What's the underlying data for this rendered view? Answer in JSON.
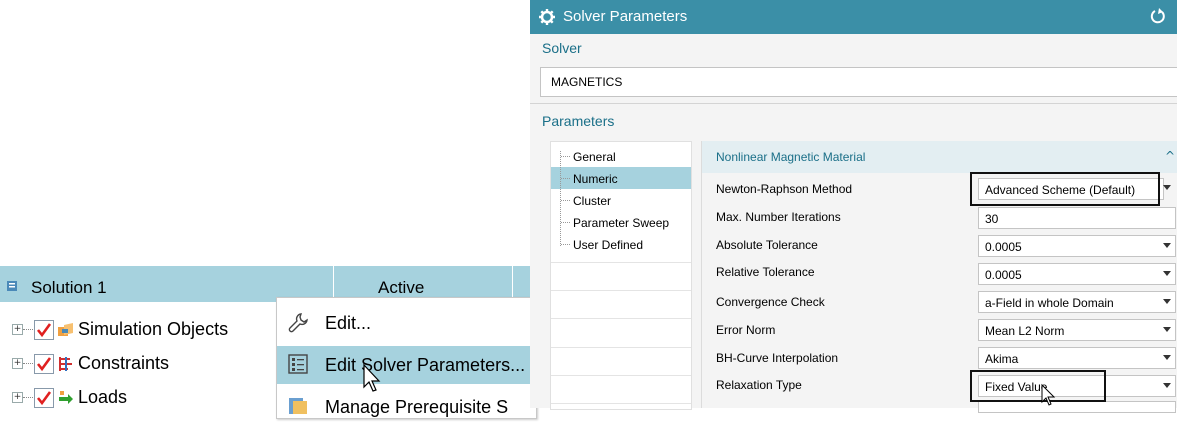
{
  "tree": {
    "header_title": "Solution 1",
    "header_column": "Active",
    "rows": [
      {
        "label": "Simulation Objects",
        "icon": "simulation-objects-icon"
      },
      {
        "label": "Constraints",
        "icon": "constraints-icon"
      },
      {
        "label": "Loads",
        "icon": "loads-icon"
      }
    ]
  },
  "context_menu": {
    "items": [
      {
        "label": "Edit...",
        "icon": "wrench-icon"
      },
      {
        "label": "Edit Solver Parameters...",
        "icon": "parameters-list-icon",
        "highlighted": true
      },
      {
        "label": "Manage Prerequisite S",
        "icon": "manage-icon"
      }
    ]
  },
  "dialog": {
    "title": "Solver Parameters",
    "solver_section": "Solver",
    "solver_value": "MAGNETICS",
    "parameters_section": "Parameters",
    "nav": [
      "General",
      "Numeric",
      "Cluster",
      "Parameter Sweep",
      "User Defined"
    ],
    "nav_selected": "Numeric",
    "panel_title": "Nonlinear Magnetic Material",
    "params": [
      {
        "label": "Newton-Raphson Method",
        "value": "Advanced Scheme (Default)",
        "dropdown": true
      },
      {
        "label": "Max. Number Iterations",
        "value": "30",
        "dropdown": false
      },
      {
        "label": "Absolute Tolerance",
        "value": "0.0005",
        "dropdown": true
      },
      {
        "label": "Relative Tolerance",
        "value": "0.0005",
        "dropdown": true
      },
      {
        "label": "Convergence Check",
        "value": "a-Field in whole Domain",
        "dropdown": true
      },
      {
        "label": "Error Norm",
        "value": "Mean L2 Norm",
        "dropdown": true
      },
      {
        "label": "BH-Curve Interpolation",
        "value": "Akima",
        "dropdown": true
      },
      {
        "label": "Relaxation Type",
        "value": "Fixed Value",
        "dropdown": true
      }
    ]
  },
  "colors": {
    "titlebar": "#3b8fa7",
    "selection": "#a6d2de",
    "section_text": "#1a6f88",
    "checkbox_red": "#e02020"
  }
}
